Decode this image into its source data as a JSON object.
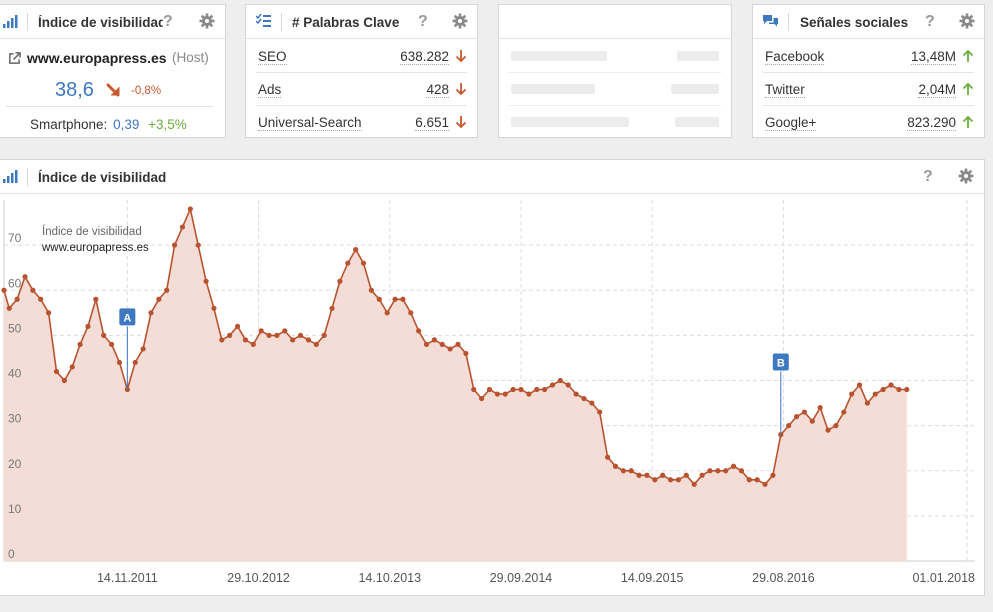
{
  "vis_card": {
    "title": "Índice de visibilidad",
    "domain": "www.europapress.es",
    "host_tag": "(Host)",
    "score": "38,6",
    "change": "-0,8%",
    "smartphone_label": "Smartphone:",
    "smartphone_value": "0,39",
    "smartphone_change": "+3,5%"
  },
  "keywords_card": {
    "title": "# Palabras Clave",
    "rows": [
      {
        "label": "SEO",
        "value": "638.282",
        "trend": "down"
      },
      {
        "label": "Ads",
        "value": "428",
        "trend": "down"
      },
      {
        "label": "Universal-Search",
        "value": "6.651",
        "trend": "down"
      }
    ]
  },
  "social_card": {
    "title": "Señales sociales",
    "rows": [
      {
        "label": "Facebook",
        "value": "13,48M",
        "trend": "up"
      },
      {
        "label": "Twitter",
        "value": "2,04M",
        "trend": "up"
      },
      {
        "label": "Google+",
        "value": "823.290",
        "trend": "up"
      }
    ]
  },
  "chart_panel": {
    "title": "Índice de visibilidad",
    "legend_title": "Índice de visibilidad",
    "legend_domain": "www.europapress.es"
  },
  "colors": {
    "line": "#b9532f",
    "area": "#f3ddd6",
    "accent_blue": "#3d78c0",
    "down": "#c9582e",
    "up": "#6aae3c"
  },
  "chart_data": {
    "type": "area",
    "title": "",
    "xlabel": "",
    "ylabel": "",
    "ylim": [
      0,
      80
    ],
    "yticks": [
      0,
      10,
      20,
      30,
      40,
      50,
      60,
      70
    ],
    "grid": true,
    "x_tick_labels": [
      "14.11.2011",
      "29.10.2012",
      "14.10.2013",
      "29.09.2014",
      "14.09.2015",
      "29.08.2016",
      "01.01.2018"
    ],
    "x_tick_dates": [
      "2011-11-14",
      "2012-10-29",
      "2013-10-14",
      "2014-09-29",
      "2015-09-14",
      "2016-08-29",
      "2018-01-01"
    ],
    "x_range": [
      "2010-12-20",
      "2018-01-22"
    ],
    "series": [
      {
        "name": "www.europapress.es",
        "points": [
          [
            "2010-12-20",
            60
          ],
          [
            "2011-01-03",
            56
          ],
          [
            "2011-01-24",
            58
          ],
          [
            "2011-02-14",
            63
          ],
          [
            "2011-03-07",
            60
          ],
          [
            "2011-03-28",
            58
          ],
          [
            "2011-04-18",
            55
          ],
          [
            "2011-05-09",
            42
          ],
          [
            "2011-05-30",
            40
          ],
          [
            "2011-06-20",
            43
          ],
          [
            "2011-07-11",
            48
          ],
          [
            "2011-08-01",
            52
          ],
          [
            "2011-08-22",
            58
          ],
          [
            "2011-09-12",
            50
          ],
          [
            "2011-10-03",
            48
          ],
          [
            "2011-10-24",
            44
          ],
          [
            "2011-11-14",
            38
          ],
          [
            "2011-12-05",
            44
          ],
          [
            "2011-12-26",
            47
          ],
          [
            "2012-01-16",
            55
          ],
          [
            "2012-02-06",
            58
          ],
          [
            "2012-02-27",
            60
          ],
          [
            "2012-03-19",
            70
          ],
          [
            "2012-04-09",
            74
          ],
          [
            "2012-04-30",
            78
          ],
          [
            "2012-05-21",
            70
          ],
          [
            "2012-06-11",
            62
          ],
          [
            "2012-07-02",
            56
          ],
          [
            "2012-07-23",
            49
          ],
          [
            "2012-08-13",
            50
          ],
          [
            "2012-09-03",
            52
          ],
          [
            "2012-09-24",
            49
          ],
          [
            "2012-10-15",
            48
          ],
          [
            "2012-11-05",
            51
          ],
          [
            "2012-11-26",
            50
          ],
          [
            "2012-12-17",
            50
          ],
          [
            "2013-01-07",
            51
          ],
          [
            "2013-01-28",
            49
          ],
          [
            "2013-02-18",
            50
          ],
          [
            "2013-03-11",
            49
          ],
          [
            "2013-04-01",
            48
          ],
          [
            "2013-04-22",
            50
          ],
          [
            "2013-05-13",
            56
          ],
          [
            "2013-06-03",
            62
          ],
          [
            "2013-06-24",
            66
          ],
          [
            "2013-07-15",
            69
          ],
          [
            "2013-08-05",
            66
          ],
          [
            "2013-08-26",
            60
          ],
          [
            "2013-09-16",
            58
          ],
          [
            "2013-10-07",
            55
          ],
          [
            "2013-10-28",
            58
          ],
          [
            "2013-11-18",
            58
          ],
          [
            "2013-12-09",
            55
          ],
          [
            "2013-12-30",
            51
          ],
          [
            "2014-01-20",
            48
          ],
          [
            "2014-02-10",
            49
          ],
          [
            "2014-03-03",
            48
          ],
          [
            "2014-03-24",
            47
          ],
          [
            "2014-04-14",
            48
          ],
          [
            "2014-05-05",
            46
          ],
          [
            "2014-05-26",
            38
          ],
          [
            "2014-06-16",
            36
          ],
          [
            "2014-07-07",
            38
          ],
          [
            "2014-07-28",
            37
          ],
          [
            "2014-08-18",
            37
          ],
          [
            "2014-09-08",
            38
          ],
          [
            "2014-09-29",
            38
          ],
          [
            "2014-10-20",
            37
          ],
          [
            "2014-11-10",
            38
          ],
          [
            "2014-12-01",
            38
          ],
          [
            "2014-12-22",
            39
          ],
          [
            "2015-01-12",
            40
          ],
          [
            "2015-02-02",
            39
          ],
          [
            "2015-02-23",
            37
          ],
          [
            "2015-03-16",
            36
          ],
          [
            "2015-04-06",
            35
          ],
          [
            "2015-04-27",
            33
          ],
          [
            "2015-05-18",
            23
          ],
          [
            "2015-06-08",
            21
          ],
          [
            "2015-06-29",
            20
          ],
          [
            "2015-07-20",
            20
          ],
          [
            "2015-08-10",
            19
          ],
          [
            "2015-08-31",
            19
          ],
          [
            "2015-09-21",
            18
          ],
          [
            "2015-10-12",
            19
          ],
          [
            "2015-11-02",
            18
          ],
          [
            "2015-11-23",
            18
          ],
          [
            "2015-12-14",
            19
          ],
          [
            "2016-01-04",
            17
          ],
          [
            "2016-01-25",
            19
          ],
          [
            "2016-02-15",
            20
          ],
          [
            "2016-03-07",
            20
          ],
          [
            "2016-03-28",
            20
          ],
          [
            "2016-04-18",
            21
          ],
          [
            "2016-05-09",
            20
          ],
          [
            "2016-05-30",
            18
          ],
          [
            "2016-06-20",
            18
          ],
          [
            "2016-07-11",
            17
          ],
          [
            "2016-08-01",
            19
          ],
          [
            "2016-08-22",
            28
          ],
          [
            "2016-09-12",
            30
          ],
          [
            "2016-10-03",
            32
          ],
          [
            "2016-10-24",
            33
          ],
          [
            "2016-11-14",
            31
          ],
          [
            "2016-12-05",
            34
          ],
          [
            "2016-12-26",
            29
          ],
          [
            "2017-01-16",
            30
          ],
          [
            "2017-02-06",
            33
          ],
          [
            "2017-02-27",
            37
          ],
          [
            "2017-03-20",
            39
          ],
          [
            "2017-04-10",
            35
          ],
          [
            "2017-05-01",
            37
          ],
          [
            "2017-05-22",
            38
          ],
          [
            "2017-06-12",
            39
          ],
          [
            "2017-07-03",
            38
          ],
          [
            "2017-07-24",
            38
          ]
        ]
      }
    ],
    "annotations": [
      {
        "label": "A",
        "date": "2011-11-14"
      },
      {
        "label": "B",
        "date": "2016-08-22"
      }
    ]
  }
}
